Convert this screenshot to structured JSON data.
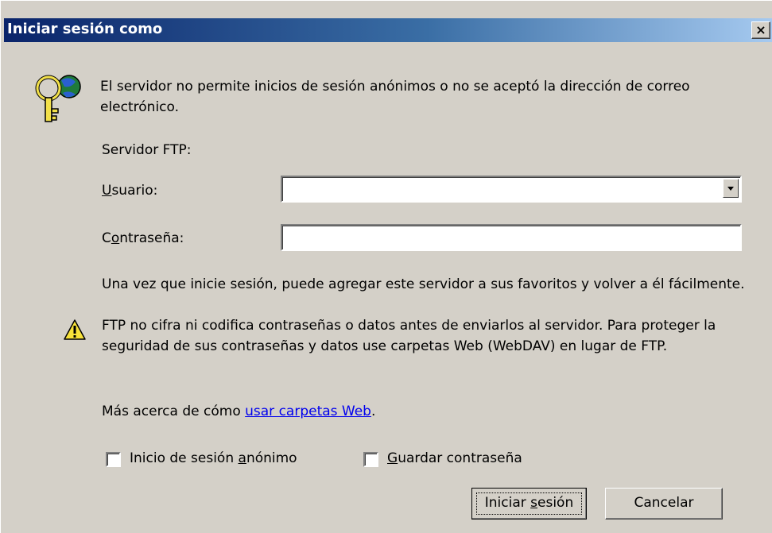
{
  "window": {
    "title": "Iniciar sesión como",
    "close_symbol": "×"
  },
  "message": {
    "icon": "keys-globe-icon",
    "text": "El servidor no permite inicios de sesión anónimos o no se aceptó la  dirección de correo electrónico."
  },
  "server_label": "Servidor FTP:",
  "user": {
    "label_accel": "U",
    "label_rest": "suario:",
    "value": ""
  },
  "password": {
    "label_pre": "C",
    "label_accel": "o",
    "label_rest": "ntraseña:",
    "value": ""
  },
  "info": {
    "text1": "Una vez que inicie sesión, puede agregar este servidor a sus favoritos y volver a él fácilmente.",
    "warning_icon": "warning-icon",
    "text2": "FTP no cifra ni codifica contraseñas o datos antes de enviarlos al servidor.  Para proteger la seguridad de sus contraseñas y datos use carpetas Web (WebDAV) en lugar de FTP.",
    "more_prefix": "Más acerca de cómo ",
    "more_link": "usar carpetas Web",
    "more_suffix": "."
  },
  "checkboxes": {
    "anonymous": {
      "pre": "Inicio de sesión ",
      "accel": "a",
      "rest": "nónimo",
      "checked": false
    },
    "save_password": {
      "pre": "",
      "accel": "G",
      "rest": "uardar contraseña",
      "checked": false
    }
  },
  "buttons": {
    "login": {
      "pre": "Iniciar ",
      "accel": "s",
      "rest": "esión"
    },
    "cancel": {
      "label": "Cancelar"
    }
  }
}
